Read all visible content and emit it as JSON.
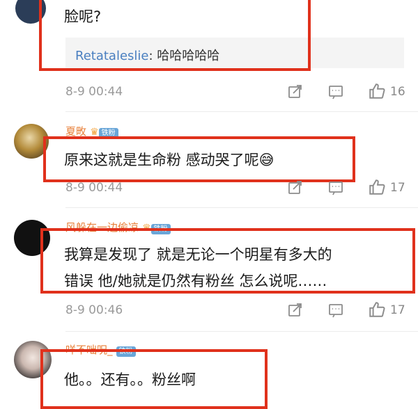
{
  "comments": [
    {
      "text": "脸呢?",
      "reply": {
        "name": "Retataleslie",
        "sep": ": ",
        "text": "哈哈哈哈哈"
      },
      "time": "8-9 00:44",
      "likes": "16"
    },
    {
      "username": "夏畋",
      "badge": "铁粉",
      "text": "原来这就是生命粉 感动哭了呢😅",
      "time": "8-9 00:44",
      "likes": "17"
    },
    {
      "username": "风躲在一边偷凉",
      "badge": "铁粉",
      "text_line1": "我算是发现了 就是无论一个明星有多大的",
      "text_line2": "错误 他/她就是仍然有粉丝 怎么说呢……",
      "time": "8-9 00:46",
      "likes": "17"
    },
    {
      "username": "咩不咄呪_",
      "badge": "铁粉",
      "text": "他。。还有。。粉丝啊"
    }
  ]
}
